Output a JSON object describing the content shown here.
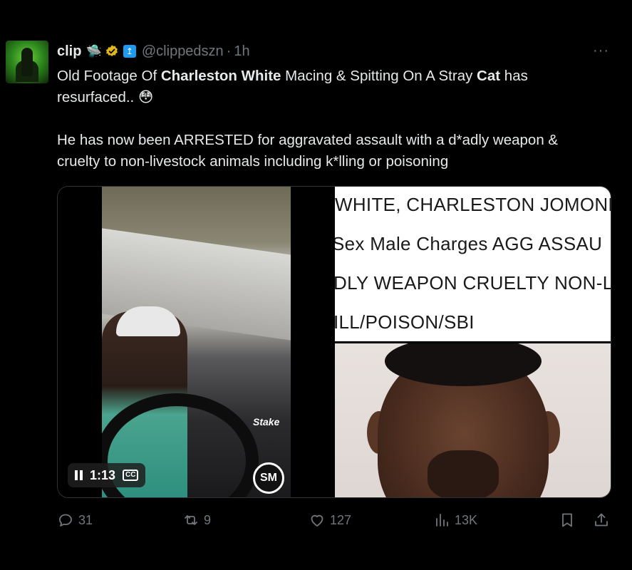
{
  "tweet": {
    "author_name": "clip",
    "name_emoji": "🛸",
    "handle": "@clippedszn",
    "separator": "·",
    "time": "1h",
    "more": "···",
    "text": {
      "line1_a": "Old Footage Of ",
      "line1_b": "Charleston White",
      "line1_c": " Macing & Spitting On A Stray ",
      "line1_d": "Cat",
      "line1_e": " has",
      "line2": "resurfaced.. 😳",
      "line3": "He has now been ARRESTED for aggravated assault with a d*adly weapon &",
      "line4": "cruelty to non-livestock animals including k*lling or poisoning"
    }
  },
  "media": {
    "video": {
      "time": "1:13",
      "cc_label": "CC",
      "watermark": "Stake",
      "logo": "SM"
    },
    "document": {
      "line1": "WHITE, CHARLESTON JOMONE",
      "line2": "Sex Male Charges AGG ASSAU",
      "line3": "DLY WEAPON CRUELTY NON-L",
      "line4": "ILL/POISON/SBI"
    }
  },
  "actions": {
    "replies": "31",
    "reposts": "9",
    "likes": "127",
    "views": "13K"
  },
  "icons": {
    "verified": "verified-badge-icon",
    "affiliate": "affiliate-badge-icon",
    "reply": "reply-icon",
    "repost": "repost-icon",
    "like": "heart-icon",
    "views": "views-icon",
    "bookmark": "bookmark-icon",
    "share": "share-icon"
  },
  "colors": {
    "background": "#000000",
    "text": "#e7e9ea",
    "muted": "#71767b",
    "verified_gold": "#e2b719",
    "accent": "#1d9bf0"
  }
}
